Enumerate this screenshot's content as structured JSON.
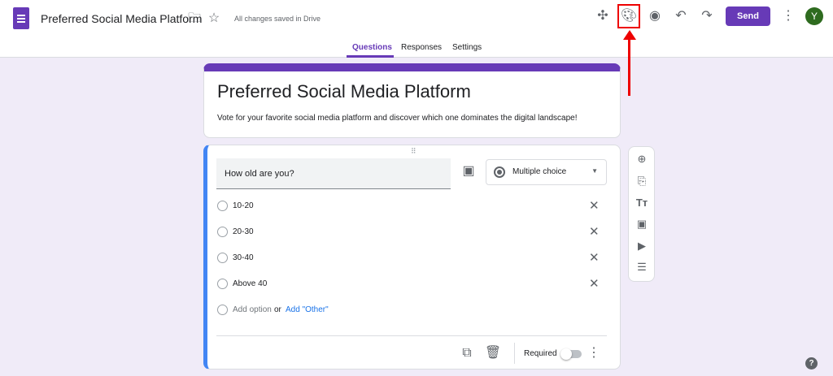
{
  "header": {
    "title": "Preferred Social Media Platform",
    "saved_status": "All changes saved in Drive",
    "send_label": "Send",
    "avatar_initial": "Y"
  },
  "tabs": [
    {
      "label": "Questions",
      "active": true
    },
    {
      "label": "Responses"
    },
    {
      "label": "Settings"
    }
  ],
  "form": {
    "title": "Preferred Social Media Platform",
    "description": "Vote for your favorite social media platform and discover which one dominates the digital landscape!"
  },
  "question": {
    "text": "How old are you?",
    "type": "Multiple choice",
    "options": [
      "10-20",
      "20-30",
      "30-40",
      "Above 40"
    ],
    "add_option": "Add option",
    "or": "or",
    "add_other": "Add \"Other\"",
    "required_label": "Required",
    "required": false
  },
  "colors": {
    "accent": "#673ab7",
    "highlight": "#e00000",
    "question_border": "#4285f4"
  }
}
